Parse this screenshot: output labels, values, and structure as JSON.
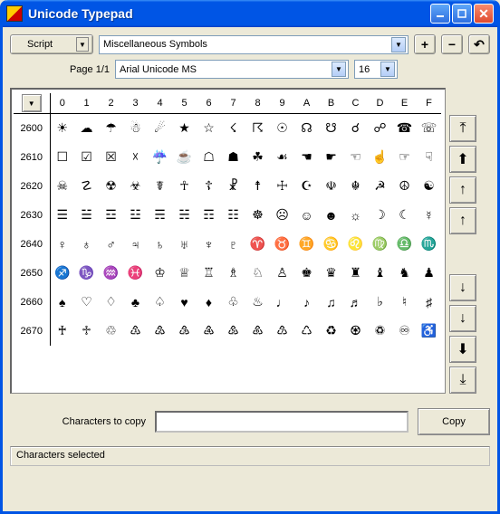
{
  "window": {
    "title": "Unicode Typepad"
  },
  "toolbar": {
    "script_label": "Script",
    "category": "Miscellaneous Symbols",
    "plus": "+",
    "minus": "−",
    "undo": "↶"
  },
  "fontrow": {
    "page_label": "Page 1/1",
    "font": "Arial Unicode MS",
    "size": "16"
  },
  "grid": {
    "columns": [
      "0",
      "1",
      "2",
      "3",
      "4",
      "5",
      "6",
      "7",
      "8",
      "9",
      "A",
      "B",
      "C",
      "D",
      "E",
      "F"
    ],
    "rows": [
      "2600",
      "2610",
      "2620",
      "2630",
      "2640",
      "2650",
      "2660",
      "2670"
    ],
    "cells": [
      [
        "☀",
        "☁",
        "☂",
        "☃",
        "☄",
        "★",
        "☆",
        "☇",
        "☈",
        "☉",
        "☊",
        "☋",
        "☌",
        "☍",
        "☎",
        "☏"
      ],
      [
        "☐",
        "☑",
        "☒",
        "☓",
        "☔",
        "☕",
        "☖",
        "☗",
        "☘",
        "☙",
        "☚",
        "☛",
        "☜",
        "☝",
        "☞",
        "☟"
      ],
      [
        "☠",
        "☡",
        "☢",
        "☣",
        "☤",
        "☥",
        "☦",
        "☧",
        "☨",
        "☩",
        "☪",
        "☫",
        "☬",
        "☭",
        "☮",
        "☯"
      ],
      [
        "☰",
        "☱",
        "☲",
        "☳",
        "☴",
        "☵",
        "☶",
        "☷",
        "☸",
        "☹",
        "☺",
        "☻",
        "☼",
        "☽",
        "☾",
        "☿"
      ],
      [
        "♀",
        "♁",
        "♂",
        "♃",
        "♄",
        "♅",
        "♆",
        "♇",
        "♈",
        "♉",
        "♊",
        "♋",
        "♌",
        "♍",
        "♎",
        "♏"
      ],
      [
        "♐",
        "♑",
        "♒",
        "♓",
        "♔",
        "♕",
        "♖",
        "♗",
        "♘",
        "♙",
        "♚",
        "♛",
        "♜",
        "♝",
        "♞",
        "♟"
      ],
      [
        "♠",
        "♡",
        "♢",
        "♣",
        "♤",
        "♥",
        "♦",
        "♧",
        "♨",
        "♩",
        "♪",
        "♫",
        "♬",
        "♭",
        "♮",
        "♯"
      ],
      [
        "♰",
        "♱",
        "♲",
        "♳",
        "♴",
        "♵",
        "♶",
        "♷",
        "♸",
        "♹",
        "♺",
        "♻",
        "♼",
        "♽",
        "♾",
        "♿"
      ]
    ]
  },
  "nav": {
    "page_top": "⤒",
    "block_up": "⬆",
    "line_up": "↑",
    "line_up2": "↑",
    "line_down": "↓",
    "line_down2": "↓",
    "block_down": "⬇",
    "page_bottom": "⤓"
  },
  "copy": {
    "label": "Characters to copy",
    "button": "Copy",
    "value": ""
  },
  "status": {
    "text": "Characters selected"
  }
}
